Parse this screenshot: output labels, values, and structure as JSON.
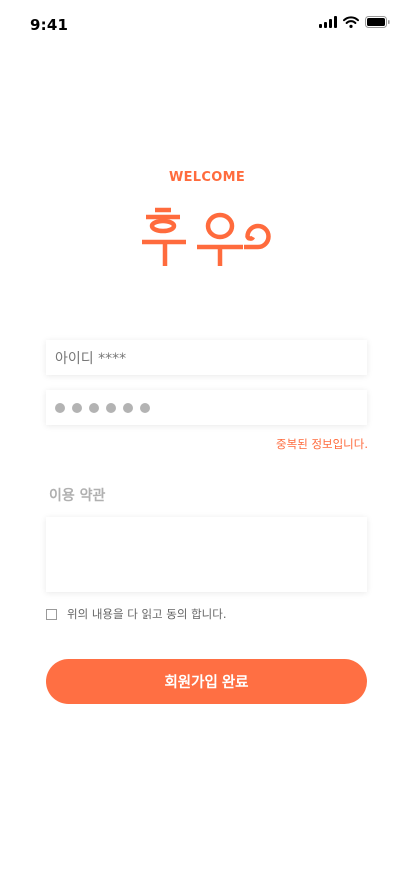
{
  "status_bar": {
    "time": "9:41",
    "icons": [
      "signal-icon",
      "wifi-icon",
      "battery-icon"
    ]
  },
  "brand": {
    "welcome": "WELCOME",
    "logo_text": "후우",
    "color": "#ff6b3d"
  },
  "form": {
    "id_value": "아이디 ****",
    "password_dot_count": 6,
    "error_message": "중복된 정보입니다.",
    "terms_title": "이용 약관",
    "terms_content": "",
    "agree_label": "위의 내용을 다 읽고 동의 합니다.",
    "agree_checked": false,
    "submit_label": "회원가입 완료"
  },
  "colors": {
    "accent": "#ff6f43",
    "error": "#ff6b3d",
    "muted": "#b0b0b0"
  }
}
